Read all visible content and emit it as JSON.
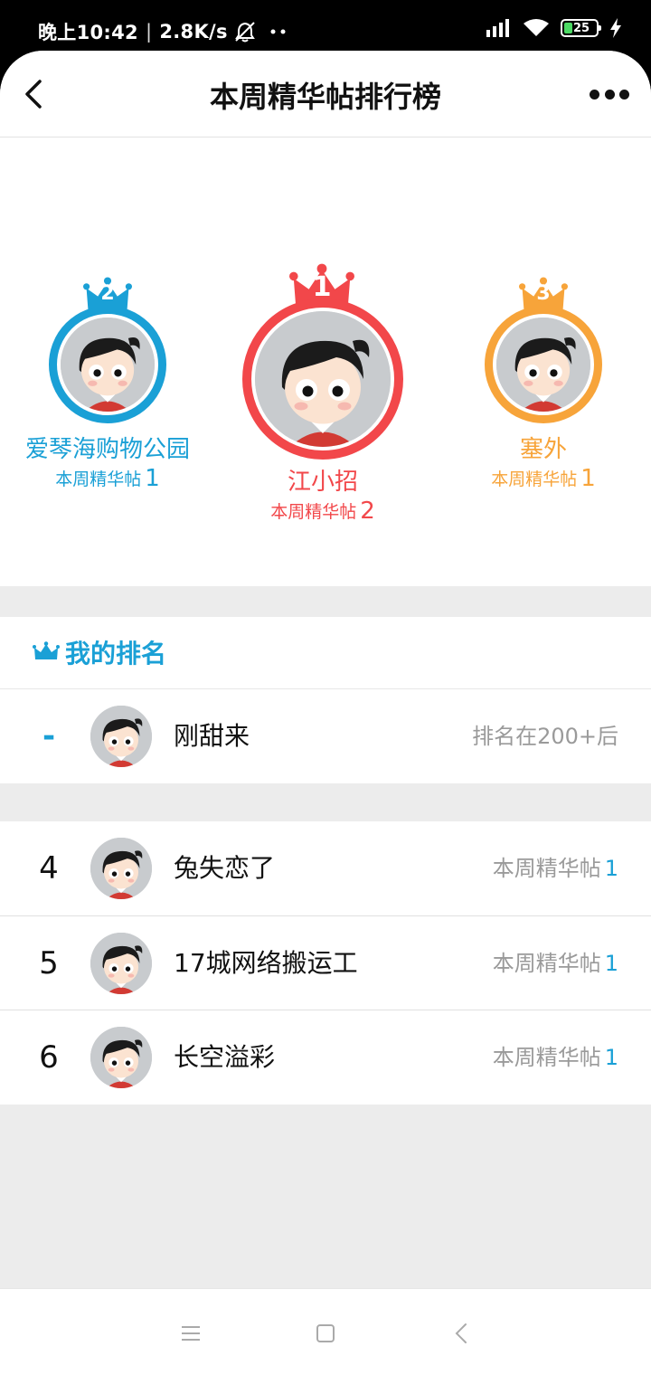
{
  "status_bar": {
    "time": "晚上10:42",
    "speed": "2.8K/s",
    "battery": "25",
    "icons": [
      "muted-bell-icon",
      "signal-icon",
      "wifi-icon",
      "battery-icon",
      "charging-icon"
    ]
  },
  "nav": {
    "title": "本周精华帖排行榜",
    "back_icon": "chevron-left-icon",
    "more_icon": "more-dots-icon"
  },
  "podium": [
    {
      "rank": "1",
      "name": "江小招",
      "sub_label": "本周精华帖",
      "count": "2",
      "color": "#f2474a"
    },
    {
      "rank": "2",
      "name": "爱琴海购物公园",
      "sub_label": "本周精华帖",
      "count": "1",
      "color": "#1aa0d6"
    },
    {
      "rank": "3",
      "name": "塞外",
      "sub_label": "本周精华帖",
      "count": "1",
      "color": "#f7a43a"
    }
  ],
  "my_rank": {
    "title": "我的排名",
    "rank": "-",
    "name": "刚甜来",
    "status": "排名在200+后"
  },
  "list": [
    {
      "rank": "4",
      "name": "兔失恋了",
      "label": "本周精华帖",
      "count": "1"
    },
    {
      "rank": "5",
      "name": "17城网络搬运工",
      "label": "本周精华帖",
      "count": "1"
    },
    {
      "rank": "6",
      "name": "长空溢彩",
      "label": "本周精华帖",
      "count": "1"
    }
  ],
  "colors": {
    "accent_blue": "#1aa0d6",
    "gold_red": "#f2474a",
    "silver_blue": "#1aa0d6",
    "bronze_orange": "#f7a43a"
  }
}
